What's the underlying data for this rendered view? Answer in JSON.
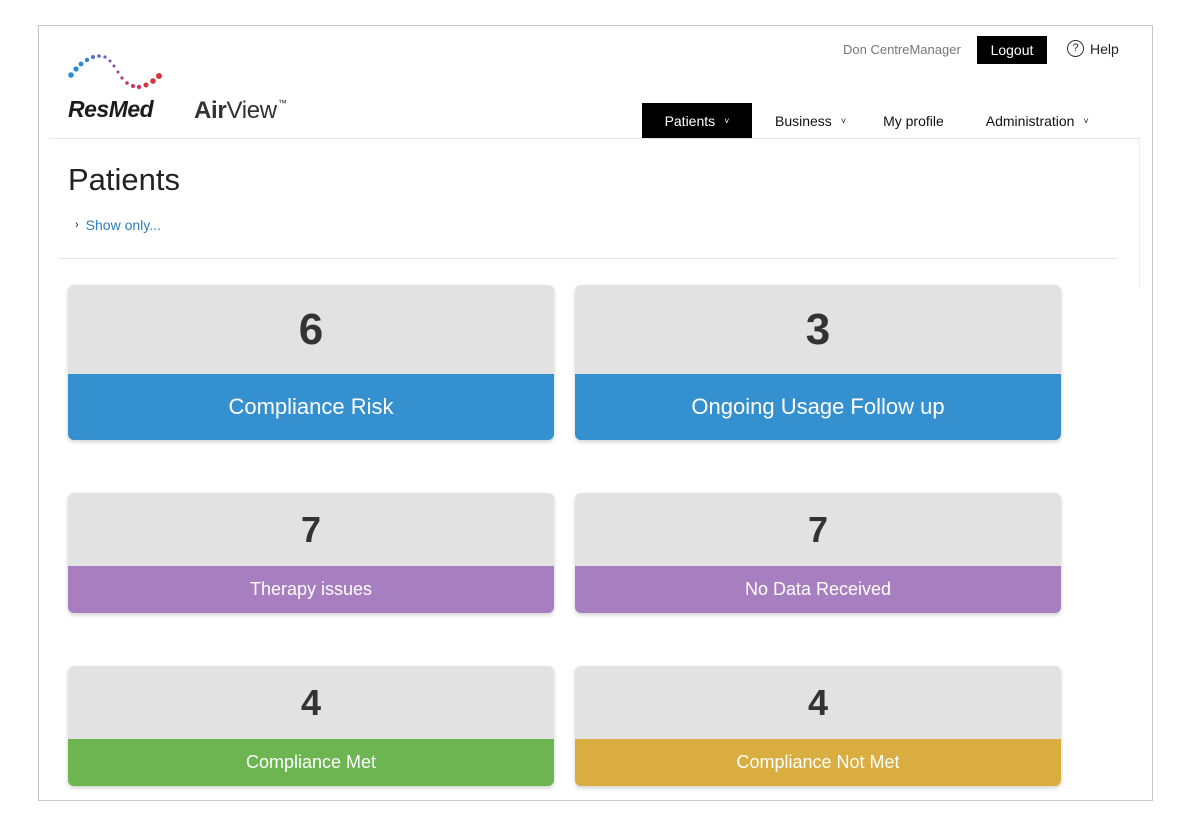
{
  "header": {
    "brand": "ResMed",
    "product_air": "Air",
    "product_view": "View",
    "product_tm": "™",
    "user_name": "Don CentreManager",
    "logout_label": "Logout",
    "help_label": "Help",
    "help_icon_glyph": "?"
  },
  "nav": {
    "items": [
      {
        "label": "Patients",
        "icon": "chevron-down-icon",
        "chevron": "˅"
      },
      {
        "label": "Business",
        "icon": "chevron-down-icon",
        "chevron": "˅"
      },
      {
        "label": "My profile"
      },
      {
        "label": "Administration",
        "icon": "chevron-down-icon",
        "chevron": "˅"
      }
    ]
  },
  "page": {
    "title": "Patients",
    "show_only_label": "Show only...",
    "show_only_caret": "›"
  },
  "tiles": [
    {
      "count": "6",
      "label": "Compliance Risk",
      "color": "#3590d0"
    },
    {
      "count": "3",
      "label": "Ongoing Usage Follow up",
      "color": "#3590d0"
    },
    {
      "count": "7",
      "label": "Therapy issues",
      "color": "#a77fc0"
    },
    {
      "count": "7",
      "label": "No Data Received",
      "color": "#a77fc0"
    },
    {
      "count": "4",
      "label": "Compliance Met",
      "color": "#6cb550"
    },
    {
      "count": "4",
      "label": "Compliance Not Met",
      "color": "#d9ad3f"
    }
  ],
  "colors": {
    "tile_background": "#e2e2e2",
    "link": "#2e7fb8",
    "logo_blue": "#2a8bd8",
    "logo_red": "#d8313f"
  }
}
